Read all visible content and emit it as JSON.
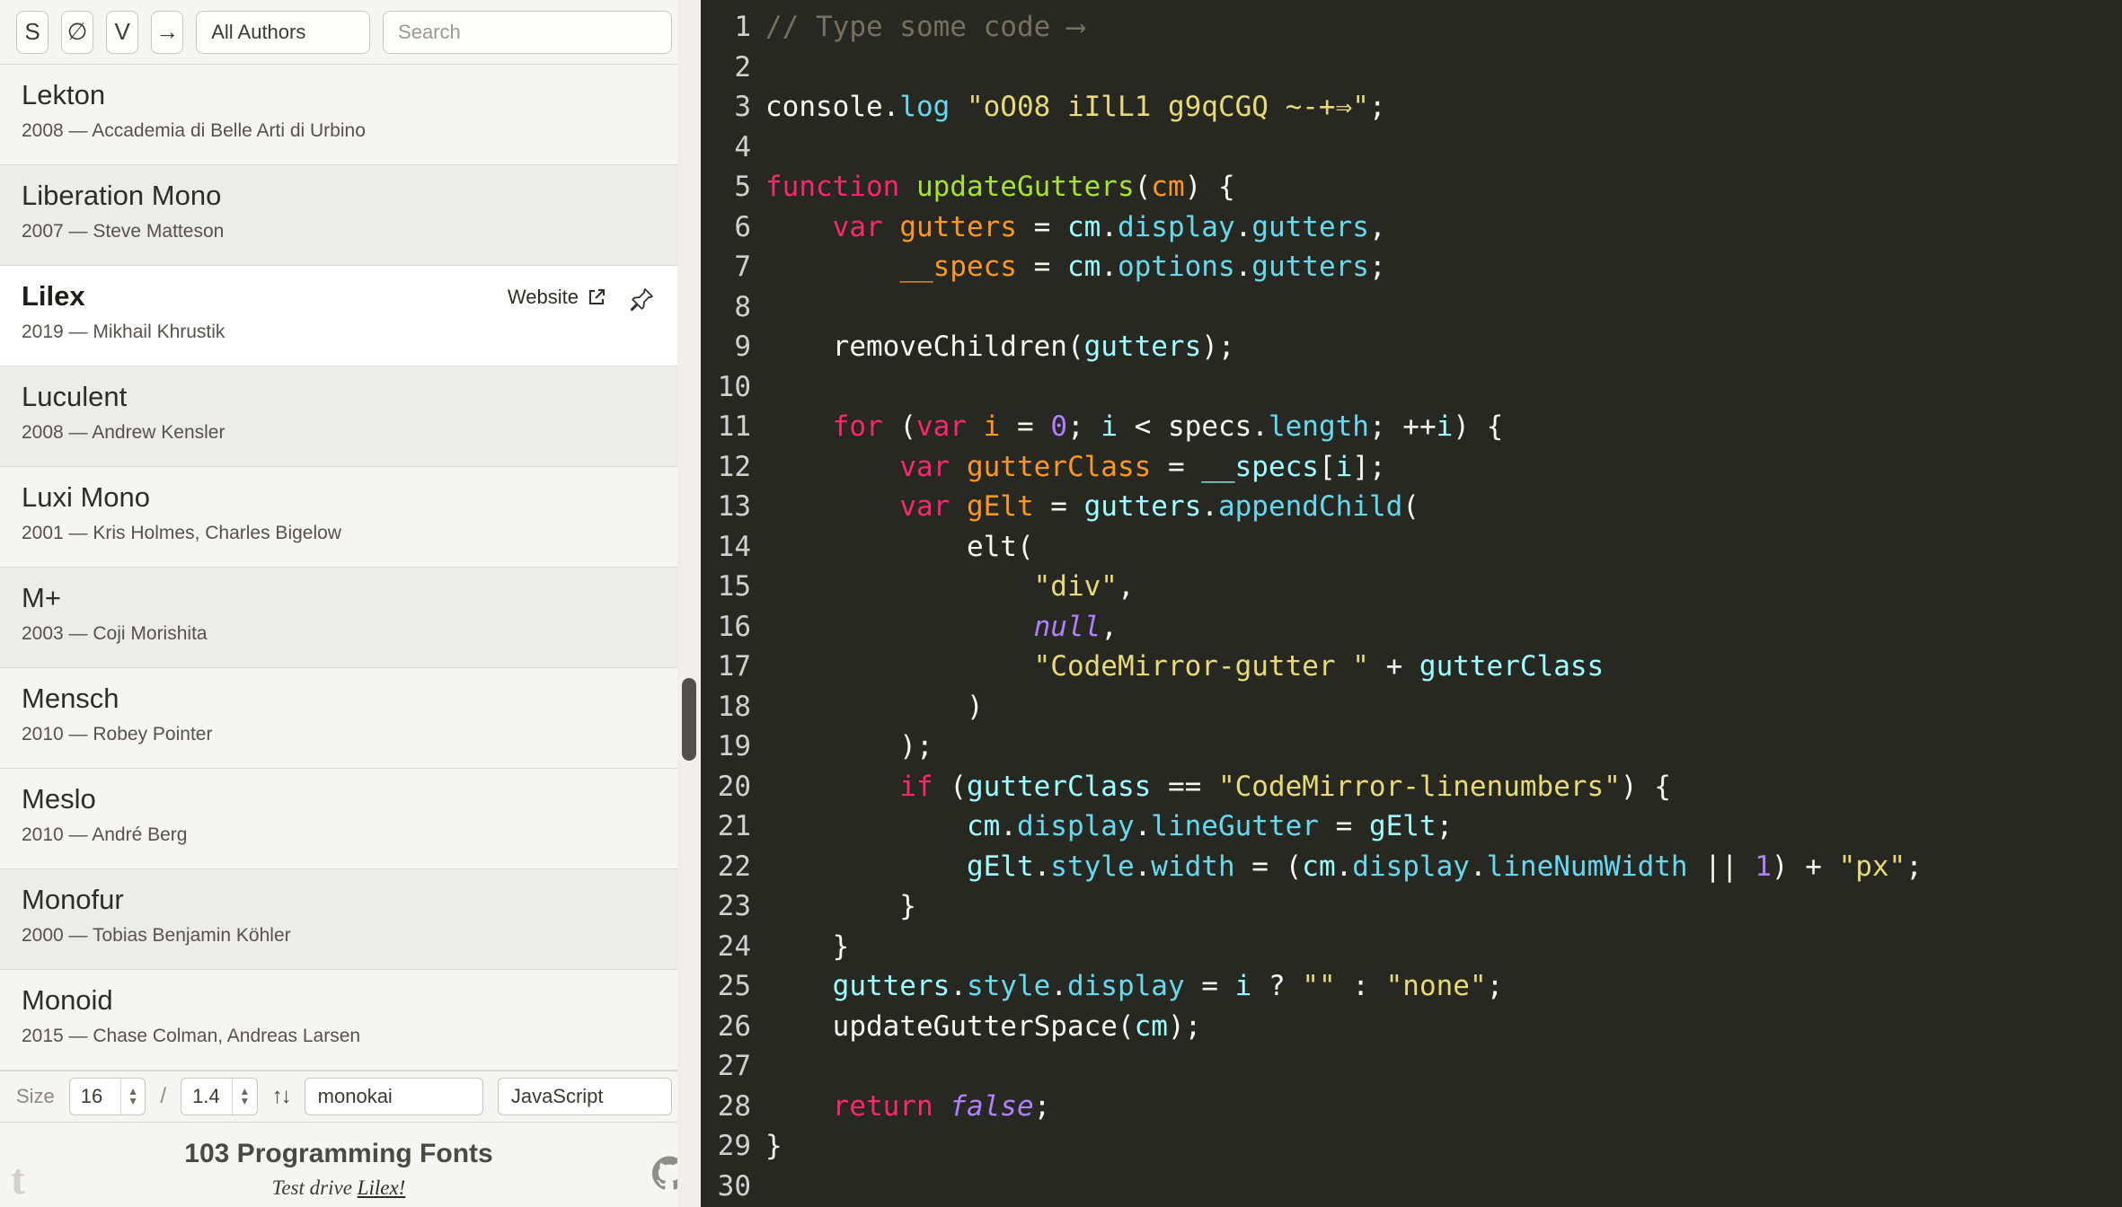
{
  "toolbar": {
    "style_button": "S",
    "zero_button": "∅",
    "v_button": "V",
    "arrow_button": "→",
    "authors_select": "All Authors",
    "search_placeholder": "Search"
  },
  "font_list": [
    {
      "name": "Lekton",
      "meta": "2008 — Accademia di Belle Arti di Urbino"
    },
    {
      "name": "Liberation Mono",
      "meta": "2007 — Steve Matteson"
    },
    {
      "name": "Lilex",
      "meta": "2019 — Mikhail Khrustik",
      "selected": true,
      "website_label": "Website"
    },
    {
      "name": "Luculent",
      "meta": "2008 — Andrew Kensler"
    },
    {
      "name": "Luxi Mono",
      "meta": "2001 — Kris Holmes, Charles Bigelow"
    },
    {
      "name": "M+",
      "meta": "2003 — Coji Morishita"
    },
    {
      "name": "Mensch",
      "meta": "2010 — Robey Pointer"
    },
    {
      "name": "Meslo",
      "meta": "2010 — André Berg"
    },
    {
      "name": "Monofur",
      "meta": "2000 — Tobias Benjamin Köhler"
    },
    {
      "name": "Monoid",
      "meta": "2015 — Chase Colman, Andreas Larsen"
    }
  ],
  "controls": {
    "size_label": "Size",
    "size_value": "16",
    "separator": "/",
    "line_height_value": "1.4",
    "updown_icon": "↑↓",
    "theme_value": "monokai",
    "language_value": "JavaScript"
  },
  "footer": {
    "count_title": "103 Programming Fonts",
    "test_drive_prefix": "Test drive ",
    "test_drive_link": "Lilex!"
  },
  "editor": {
    "theme_name": "monokai",
    "palette": {
      "background": "#272822",
      "line_number": "#d0d0d0",
      "comment": "#75715e",
      "keyword": "#f92672",
      "string": "#e6db74",
      "number_atom": "#ae81ff",
      "function_def": "#a6e22e",
      "definition": "#fd971f",
      "property": "#66d9ef",
      "local_variable": "#9effff",
      "text": "#f8f8f2"
    },
    "lines": [
      {
        "n": 1,
        "tokens": [
          [
            "comment",
            "// Type some code ⟶"
          ]
        ]
      },
      {
        "n": 2,
        "tokens": []
      },
      {
        "n": 3,
        "tokens": [
          [
            "plain",
            "console."
          ],
          [
            "prop",
            "log"
          ],
          [
            "plain",
            " "
          ],
          [
            "string",
            "\"oO08 iIlL1 g9qCGQ ~-+⇒\""
          ],
          [
            "plain",
            ";"
          ]
        ]
      },
      {
        "n": 4,
        "tokens": []
      },
      {
        "n": 5,
        "tokens": [
          [
            "keyword",
            "function"
          ],
          [
            "plain",
            " "
          ],
          [
            "fn",
            "updateGutters"
          ],
          [
            "plain",
            "("
          ],
          [
            "def",
            "cm"
          ],
          [
            "plain",
            ") {"
          ]
        ]
      },
      {
        "n": 6,
        "tokens": [
          [
            "plain",
            "    "
          ],
          [
            "keyword",
            "var"
          ],
          [
            "plain",
            " "
          ],
          [
            "def",
            "gutters"
          ],
          [
            "plain",
            " = "
          ],
          [
            "var2",
            "cm"
          ],
          [
            "plain",
            "."
          ],
          [
            "prop",
            "display"
          ],
          [
            "plain",
            "."
          ],
          [
            "prop",
            "gutters"
          ],
          [
            "plain",
            ","
          ]
        ]
      },
      {
        "n": 7,
        "tokens": [
          [
            "plain",
            "        "
          ],
          [
            "def",
            "__specs"
          ],
          [
            "plain",
            " = "
          ],
          [
            "var2",
            "cm"
          ],
          [
            "plain",
            "."
          ],
          [
            "prop",
            "options"
          ],
          [
            "plain",
            "."
          ],
          [
            "prop",
            "gutters"
          ],
          [
            "plain",
            ";"
          ]
        ]
      },
      {
        "n": 8,
        "tokens": []
      },
      {
        "n": 9,
        "tokens": [
          [
            "plain",
            "    removeChildren("
          ],
          [
            "var2",
            "gutters"
          ],
          [
            "plain",
            ");"
          ]
        ]
      },
      {
        "n": 10,
        "tokens": []
      },
      {
        "n": 11,
        "tokens": [
          [
            "plain",
            "    "
          ],
          [
            "keyword",
            "for"
          ],
          [
            "plain",
            " ("
          ],
          [
            "keyword",
            "var"
          ],
          [
            "plain",
            " "
          ],
          [
            "def",
            "i"
          ],
          [
            "plain",
            " = "
          ],
          [
            "num",
            "0"
          ],
          [
            "plain",
            "; "
          ],
          [
            "var2",
            "i"
          ],
          [
            "plain",
            " < specs."
          ],
          [
            "prop",
            "length"
          ],
          [
            "plain",
            "; ++"
          ],
          [
            "var2",
            "i"
          ],
          [
            "plain",
            ") {"
          ]
        ]
      },
      {
        "n": 12,
        "tokens": [
          [
            "plain",
            "        "
          ],
          [
            "keyword",
            "var"
          ],
          [
            "plain",
            " "
          ],
          [
            "def",
            "gutterClass"
          ],
          [
            "plain",
            " = "
          ],
          [
            "var2",
            "__specs"
          ],
          [
            "plain",
            "["
          ],
          [
            "var2",
            "i"
          ],
          [
            "plain",
            "];"
          ]
        ]
      },
      {
        "n": 13,
        "tokens": [
          [
            "plain",
            "        "
          ],
          [
            "keyword",
            "var"
          ],
          [
            "plain",
            " "
          ],
          [
            "def",
            "gElt"
          ],
          [
            "plain",
            " = "
          ],
          [
            "var2",
            "gutters"
          ],
          [
            "plain",
            "."
          ],
          [
            "prop",
            "appendChild"
          ],
          [
            "plain",
            "("
          ]
        ]
      },
      {
        "n": 14,
        "tokens": [
          [
            "plain",
            "            elt("
          ]
        ]
      },
      {
        "n": 15,
        "tokens": [
          [
            "plain",
            "                "
          ],
          [
            "string",
            "\"div\""
          ],
          [
            "plain",
            ","
          ]
        ]
      },
      {
        "n": 16,
        "tokens": [
          [
            "plain",
            "                "
          ],
          [
            "atom",
            "null"
          ],
          [
            "plain",
            ","
          ]
        ]
      },
      {
        "n": 17,
        "tokens": [
          [
            "plain",
            "                "
          ],
          [
            "string",
            "\"CodeMirror-gutter \""
          ],
          [
            "plain",
            " + "
          ],
          [
            "var2",
            "gutterClass"
          ]
        ]
      },
      {
        "n": 18,
        "tokens": [
          [
            "plain",
            "            )"
          ]
        ]
      },
      {
        "n": 19,
        "tokens": [
          [
            "plain",
            "        );"
          ]
        ]
      },
      {
        "n": 20,
        "tokens": [
          [
            "plain",
            "        "
          ],
          [
            "keyword",
            "if"
          ],
          [
            "plain",
            " ("
          ],
          [
            "var2",
            "gutterClass"
          ],
          [
            "plain",
            " == "
          ],
          [
            "string",
            "\"CodeMirror-linenumbers\""
          ],
          [
            "plain",
            ") {"
          ]
        ]
      },
      {
        "n": 21,
        "tokens": [
          [
            "plain",
            "            "
          ],
          [
            "var2",
            "cm"
          ],
          [
            "plain",
            "."
          ],
          [
            "prop",
            "display"
          ],
          [
            "plain",
            "."
          ],
          [
            "prop",
            "lineGutter"
          ],
          [
            "plain",
            " = "
          ],
          [
            "var2",
            "gElt"
          ],
          [
            "plain",
            ";"
          ]
        ]
      },
      {
        "n": 22,
        "tokens": [
          [
            "plain",
            "            "
          ],
          [
            "var2",
            "gElt"
          ],
          [
            "plain",
            "."
          ],
          [
            "prop",
            "style"
          ],
          [
            "plain",
            "."
          ],
          [
            "prop",
            "width"
          ],
          [
            "plain",
            " = ("
          ],
          [
            "var2",
            "cm"
          ],
          [
            "plain",
            "."
          ],
          [
            "prop",
            "display"
          ],
          [
            "plain",
            "."
          ],
          [
            "prop",
            "lineNumWidth"
          ],
          [
            "plain",
            " || "
          ],
          [
            "num",
            "1"
          ],
          [
            "plain",
            ") + "
          ],
          [
            "string",
            "\"px\""
          ],
          [
            "plain",
            ";"
          ]
        ]
      },
      {
        "n": 23,
        "tokens": [
          [
            "plain",
            "        }"
          ]
        ]
      },
      {
        "n": 24,
        "tokens": [
          [
            "plain",
            "    }"
          ]
        ]
      },
      {
        "n": 25,
        "tokens": [
          [
            "plain",
            "    "
          ],
          [
            "var2",
            "gutters"
          ],
          [
            "plain",
            "."
          ],
          [
            "prop",
            "style"
          ],
          [
            "plain",
            "."
          ],
          [
            "prop",
            "display"
          ],
          [
            "plain",
            " = "
          ],
          [
            "var2",
            "i"
          ],
          [
            "plain",
            " ? "
          ],
          [
            "string",
            "\"\""
          ],
          [
            "plain",
            " : "
          ],
          [
            "string",
            "\"none\""
          ],
          [
            "plain",
            ";"
          ]
        ]
      },
      {
        "n": 26,
        "tokens": [
          [
            "plain",
            "    updateGutterSpace("
          ],
          [
            "var2",
            "cm"
          ],
          [
            "plain",
            ");"
          ]
        ]
      },
      {
        "n": 27,
        "tokens": []
      },
      {
        "n": 28,
        "tokens": [
          [
            "plain",
            "    "
          ],
          [
            "keyword",
            "return"
          ],
          [
            "plain",
            " "
          ],
          [
            "atom",
            "false"
          ],
          [
            "plain",
            ";"
          ]
        ]
      },
      {
        "n": 29,
        "tokens": [
          [
            "plain",
            "}"
          ]
        ]
      },
      {
        "n": 30,
        "tokens": []
      }
    ]
  }
}
